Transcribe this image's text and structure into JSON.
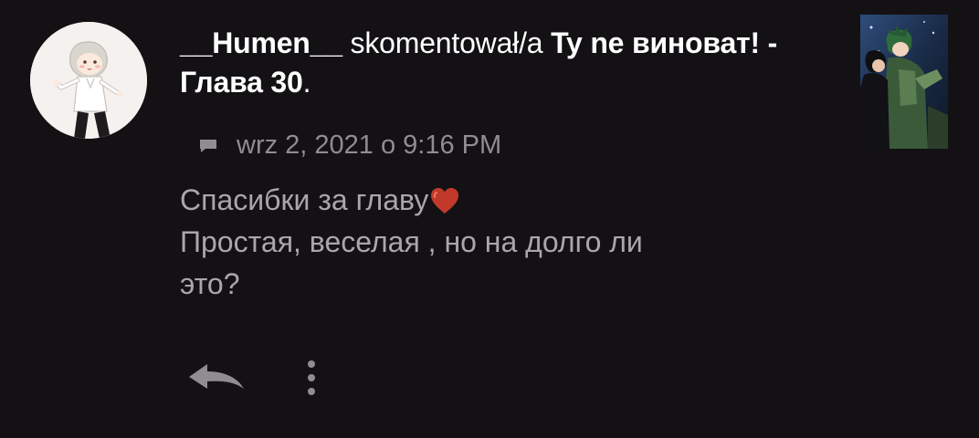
{
  "comment": {
    "username": "__Humen__",
    "verb": " skomentował/a ",
    "chapter_title": "Ty ne виноват! - Глава 30",
    "period": ".",
    "timestamp": "wrz 2, 2021 o 9:16 PM",
    "text_lines": [
      "Спасибки за главу",
      "Простая, веселая , но на долго ли",
      "это?"
    ]
  },
  "icons": {
    "comment": "comment-icon",
    "heart": "heart-icon",
    "reply": "reply-icon",
    "more": "more-vertical-icon"
  },
  "colors": {
    "background": "#131114",
    "primary_text": "#ffffff",
    "body_text": "#a9a7ab",
    "meta_text": "#8f8d91",
    "heart": "#c0392b"
  }
}
